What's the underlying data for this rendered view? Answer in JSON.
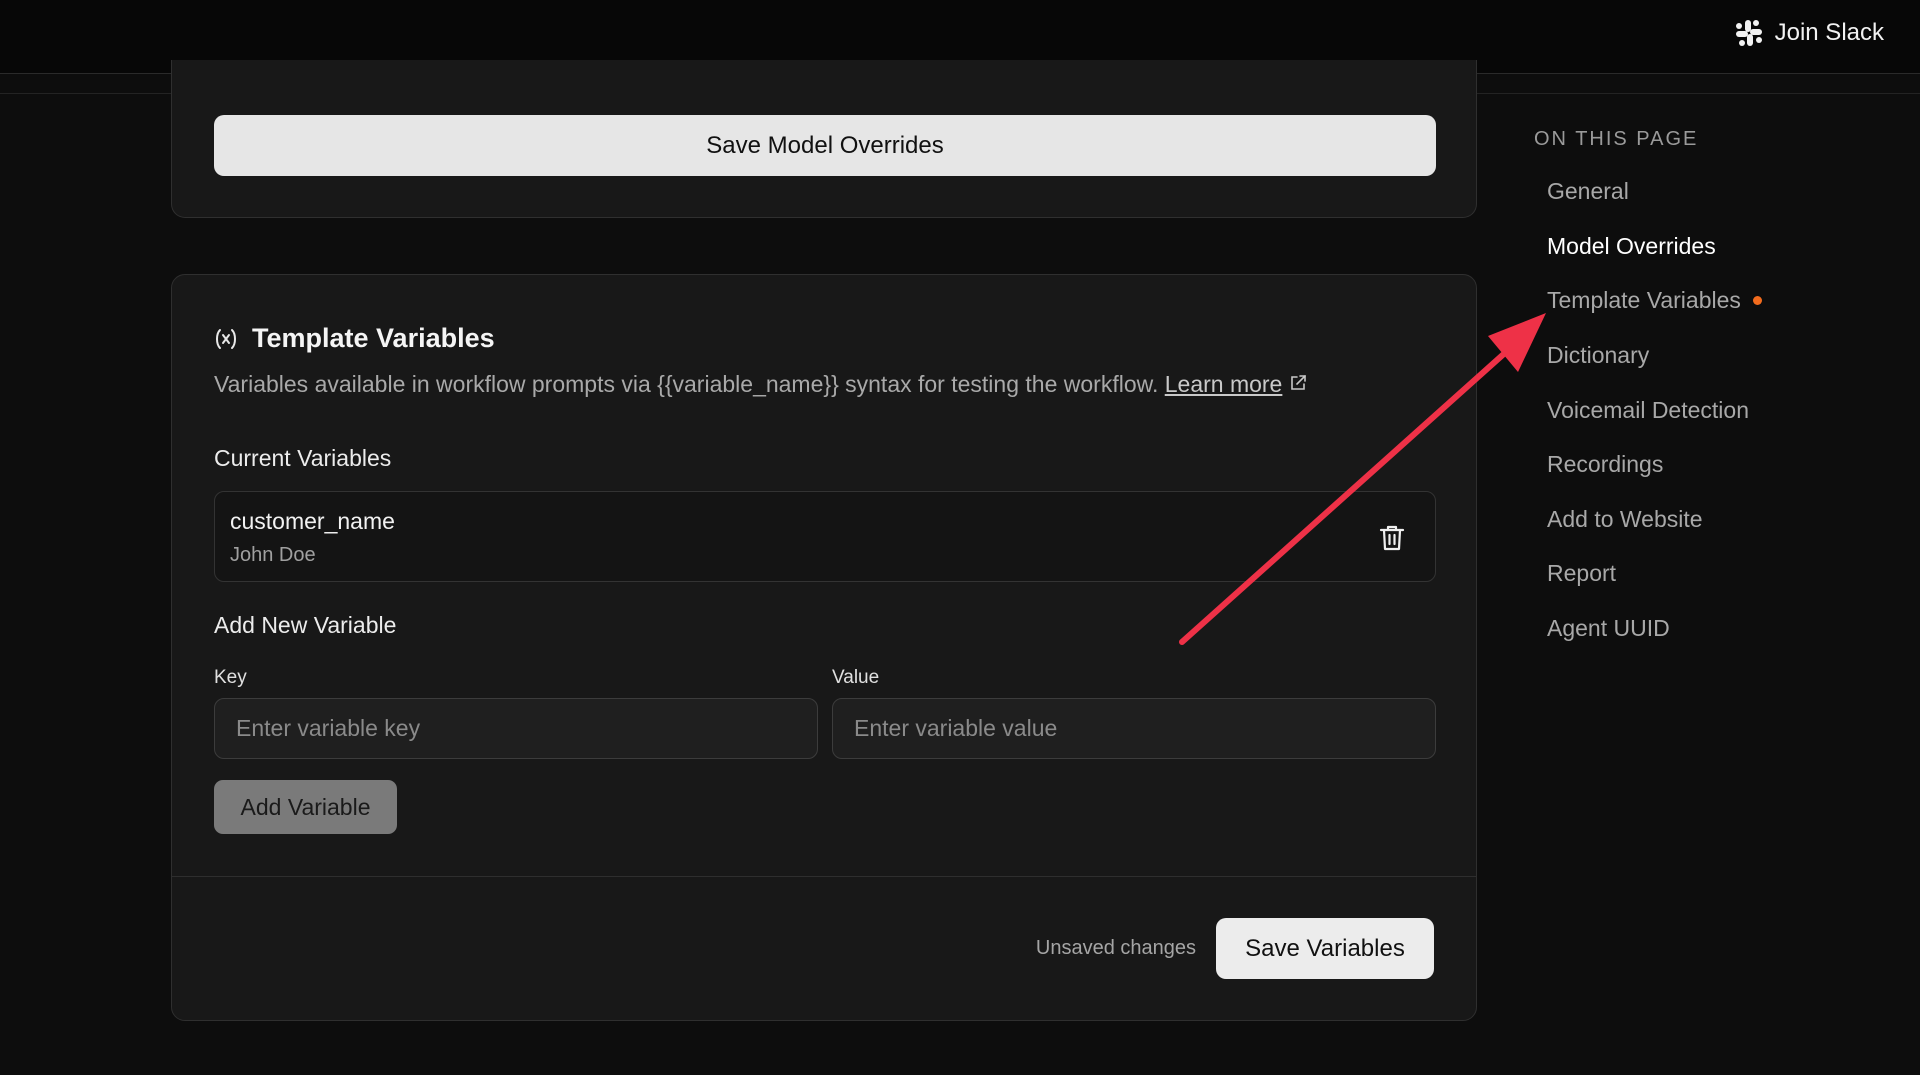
{
  "header": {
    "join_slack_label": "Join Slack",
    "icon": "slack-icon"
  },
  "model_overrides": {
    "save_label": "Save Model Overrides"
  },
  "template_variables": {
    "icon": "variable-icon",
    "title": "Template Variables",
    "description": "Variables available in workflow prompts via {{variable_name}} syntax for testing the workflow.",
    "learn_more": "Learn more",
    "current_label": "Current Variables",
    "variables": [
      {
        "key": "customer_name",
        "value": "John Doe"
      }
    ],
    "add_new_label": "Add New Variable",
    "key_label": "Key",
    "key_placeholder": "Enter variable key",
    "value_label": "Value",
    "value_placeholder": "Enter variable value",
    "add_button": "Add Variable",
    "unsaved_text": "Unsaved changes",
    "save_button": "Save Variables"
  },
  "toc": {
    "heading": "ON THIS PAGE",
    "items": [
      {
        "label": "General"
      },
      {
        "label": "Model Overrides",
        "active": true
      },
      {
        "label": "Template Variables",
        "indicator": true
      },
      {
        "label": "Dictionary"
      },
      {
        "label": "Voicemail Detection"
      },
      {
        "label": "Recordings"
      },
      {
        "label": "Add to Website"
      },
      {
        "label": "Report"
      },
      {
        "label": "Agent UUID"
      }
    ]
  },
  "colors": {
    "indicator": "#f26b1d",
    "annotation_arrow": "#ee3147"
  }
}
